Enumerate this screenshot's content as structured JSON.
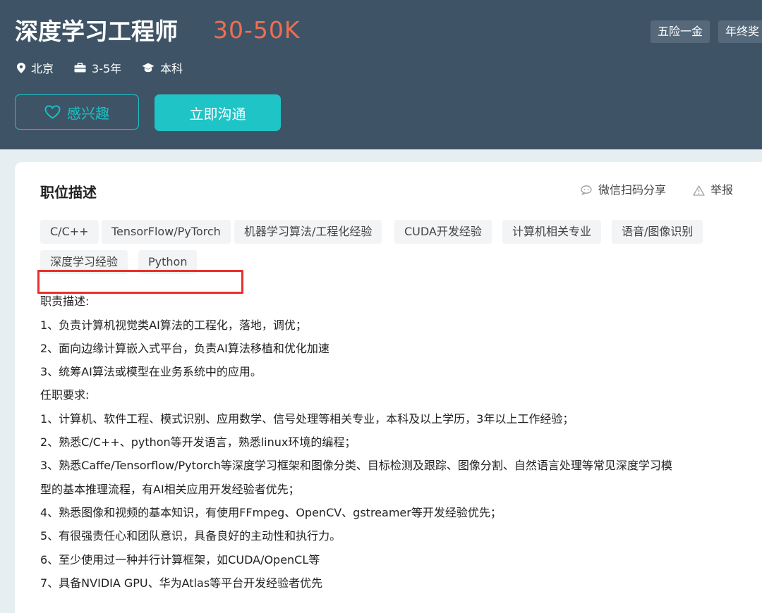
{
  "header": {
    "title": "深度学习工程师",
    "salary": "30-50K",
    "benefits": [
      "五险一金",
      "年终奖"
    ],
    "location": "北京",
    "experience": "3-5年",
    "education": "本科",
    "interest_button": "感兴趣",
    "chat_button": "立即沟通"
  },
  "card": {
    "title": "职位描述",
    "share": "微信扫码分享",
    "report": "举报",
    "tags": [
      "C/C++",
      "TensorFlow/PyTorch",
      "机器学习算法/工程化经验",
      "CUDA开发经验",
      "计算机相关专业",
      "语音/图像识别",
      "深度学习经验",
      "Python"
    ],
    "lines": [
      "职责描述:",
      "1、负责计算机视觉类AI算法的工程化，落地，调优；",
      "2、面向边缘计算嵌入式平台，负责AI算法移植和优化加速",
      "3、统筹AI算法或模型在业务系统中的应用。",
      "任职要求:",
      "1、计算机、软件工程、模式识别、应用数学、信号处理等相关专业，本科及以上学历，3年以上工作经验；",
      "2、熟悉C/C++、python等开发语言，熟悉linux环境的编程；",
      "3、熟悉Caffe/Tensorflow/Pytorch等深度学习框架和图像分类、目标检测及跟踪、图像分割、自然语言处理等常见深度学习模",
      "型的基本推理流程，有AI相关应用开发经验者优先；",
      "4、熟悉图像和视频的基本知识，有使用FFmpeg、OpenCV、gstreamer等开发经验优先；",
      "5、有很强责任心和团队意识，具备良好的主动性和执行力。",
      "6、至少使用过一种并行计算框架，如CUDA/OpenCL等",
      "7、具备NVIDIA GPU、华为Atlas等平台开发经验者优先"
    ]
  }
}
